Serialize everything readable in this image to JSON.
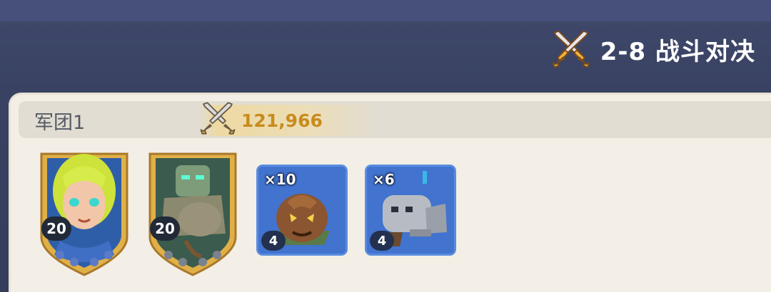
{
  "header": {
    "stage_title": "2-8 战斗对决",
    "stage_icon": "crossed-swords-icon"
  },
  "army": {
    "name": "军团1",
    "power": "121,966",
    "power_icon": "crossed-swords-icon",
    "heroes": [
      {
        "name": "elf-hero",
        "level": "20"
      },
      {
        "name": "stone-golem-hero",
        "level": "20"
      }
    ],
    "troops": [
      {
        "name": "pumpkin-spirit-troop",
        "count": "×10",
        "level": "4"
      },
      {
        "name": "robot-knight-troop",
        "count": "×6",
        "level": "4"
      }
    ]
  },
  "colors": {
    "background": "#3a4364",
    "panel": "#f3efe6",
    "power_text": "#c98b1c",
    "troop_card": "#3e6fc9",
    "shield_gold": "#e0b047"
  }
}
